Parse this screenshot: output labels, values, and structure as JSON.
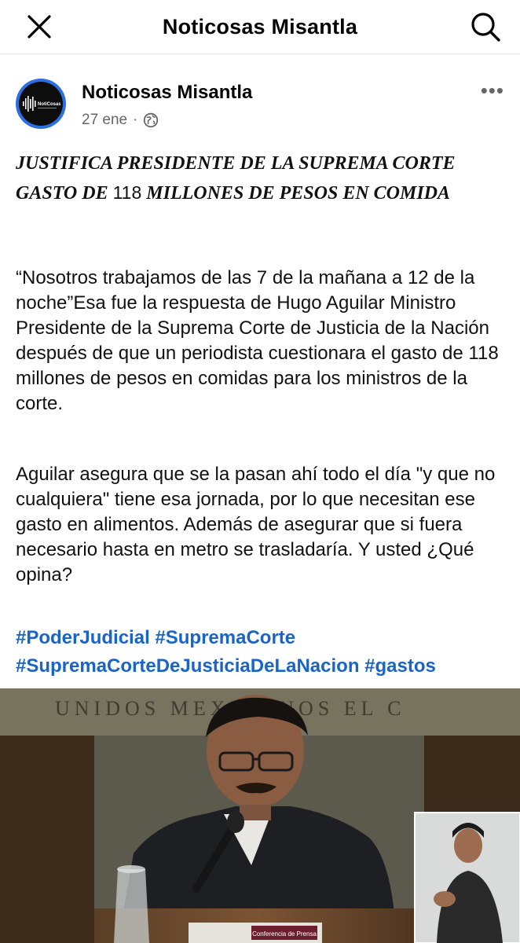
{
  "header": {
    "title": "Noticosas Misantla"
  },
  "post": {
    "page_name": "Noticosas Misantla",
    "date": "27 ene",
    "separator": "·",
    "headline": {
      "part1": "JUSTIFICA PRESIDENTE DE LA SUPREMA CORTE GASTO DE ",
      "number": "118",
      "part2": " MILLONES DE PESOS EN COMIDA"
    },
    "paragraph1": "“Nosotros trabajamos de las 7 de la mañana a 12 de la noche”Esa fue la respuesta de Hugo Aguilar Ministro Presidente de la Suprema Corte de Justicia de la Nación después de que un periodista cuestionara el gasto de 118 millones de pesos en comidas para los ministros de la corte.",
    "paragraph2": "Aguilar asegura que se la pasan ahí todo el día \"y que no cualquiera\" tiene esa jornada, por lo que necesitan ese gasto en alimentos. Además de asegurar que si fuera necesario hasta en metro se trasladaría. Y usted ¿Qué opina?",
    "hashtags": [
      "#PoderJudicial",
      "#SupremaCorte",
      "#SupremaCorteDeJusticiaDeLaNacion",
      "#gastos"
    ],
    "avatar_text": "NotiCosas",
    "image": {
      "wall_text": "UNIDOS MEXICANOS EL C",
      "banner_label": "Conferencia de Prensa"
    }
  },
  "colors": {
    "link": "#1864c8",
    "meta": "#65676b",
    "avatar_ring": "#2c6fe0"
  },
  "icons": [
    "close-icon",
    "search-icon",
    "globe-icon",
    "more-icon"
  ]
}
